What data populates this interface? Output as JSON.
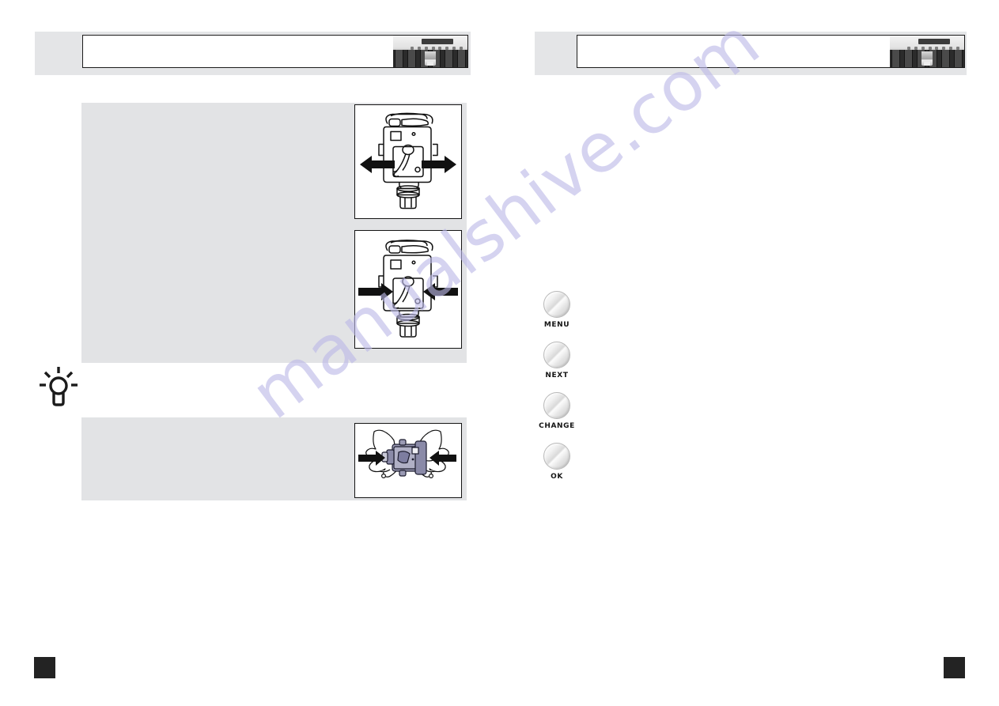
{
  "document": {
    "type": "manual-page-spread",
    "watermark_text": "manualshive.com",
    "watermark_color": "#bcb9e8"
  },
  "left_page": {
    "header": {
      "title": "",
      "machine_photo_name": "espresso-machine-photo"
    },
    "blocks": [
      {
        "id": "upper",
        "text": ""
      },
      {
        "id": "lower",
        "text": ""
      }
    ],
    "figures": [
      {
        "id": "figure-1",
        "caption": "",
        "arrows": "outward"
      },
      {
        "id": "figure-2",
        "caption": "",
        "arrows": "inward"
      },
      {
        "id": "figure-3",
        "caption": "",
        "arrows": "inward-hands"
      }
    ],
    "tip_icon": "lightbulb-icon",
    "page_number": ""
  },
  "right_page": {
    "header": {
      "title": "",
      "machine_photo_name": "espresso-machine-photo"
    },
    "controls": [
      {
        "label": "MENU",
        "name": "menu-button"
      },
      {
        "label": "NEXT",
        "name": "next-button"
      },
      {
        "label": "CHANGE",
        "name": "change-button"
      },
      {
        "label": "OK",
        "name": "ok-button"
      }
    ],
    "page_number": ""
  },
  "colors": {
    "block_gray": "#e2e3e5",
    "header_gray": "#e4e5e7",
    "ink": "#1c1c1c",
    "marker": "#232323"
  }
}
